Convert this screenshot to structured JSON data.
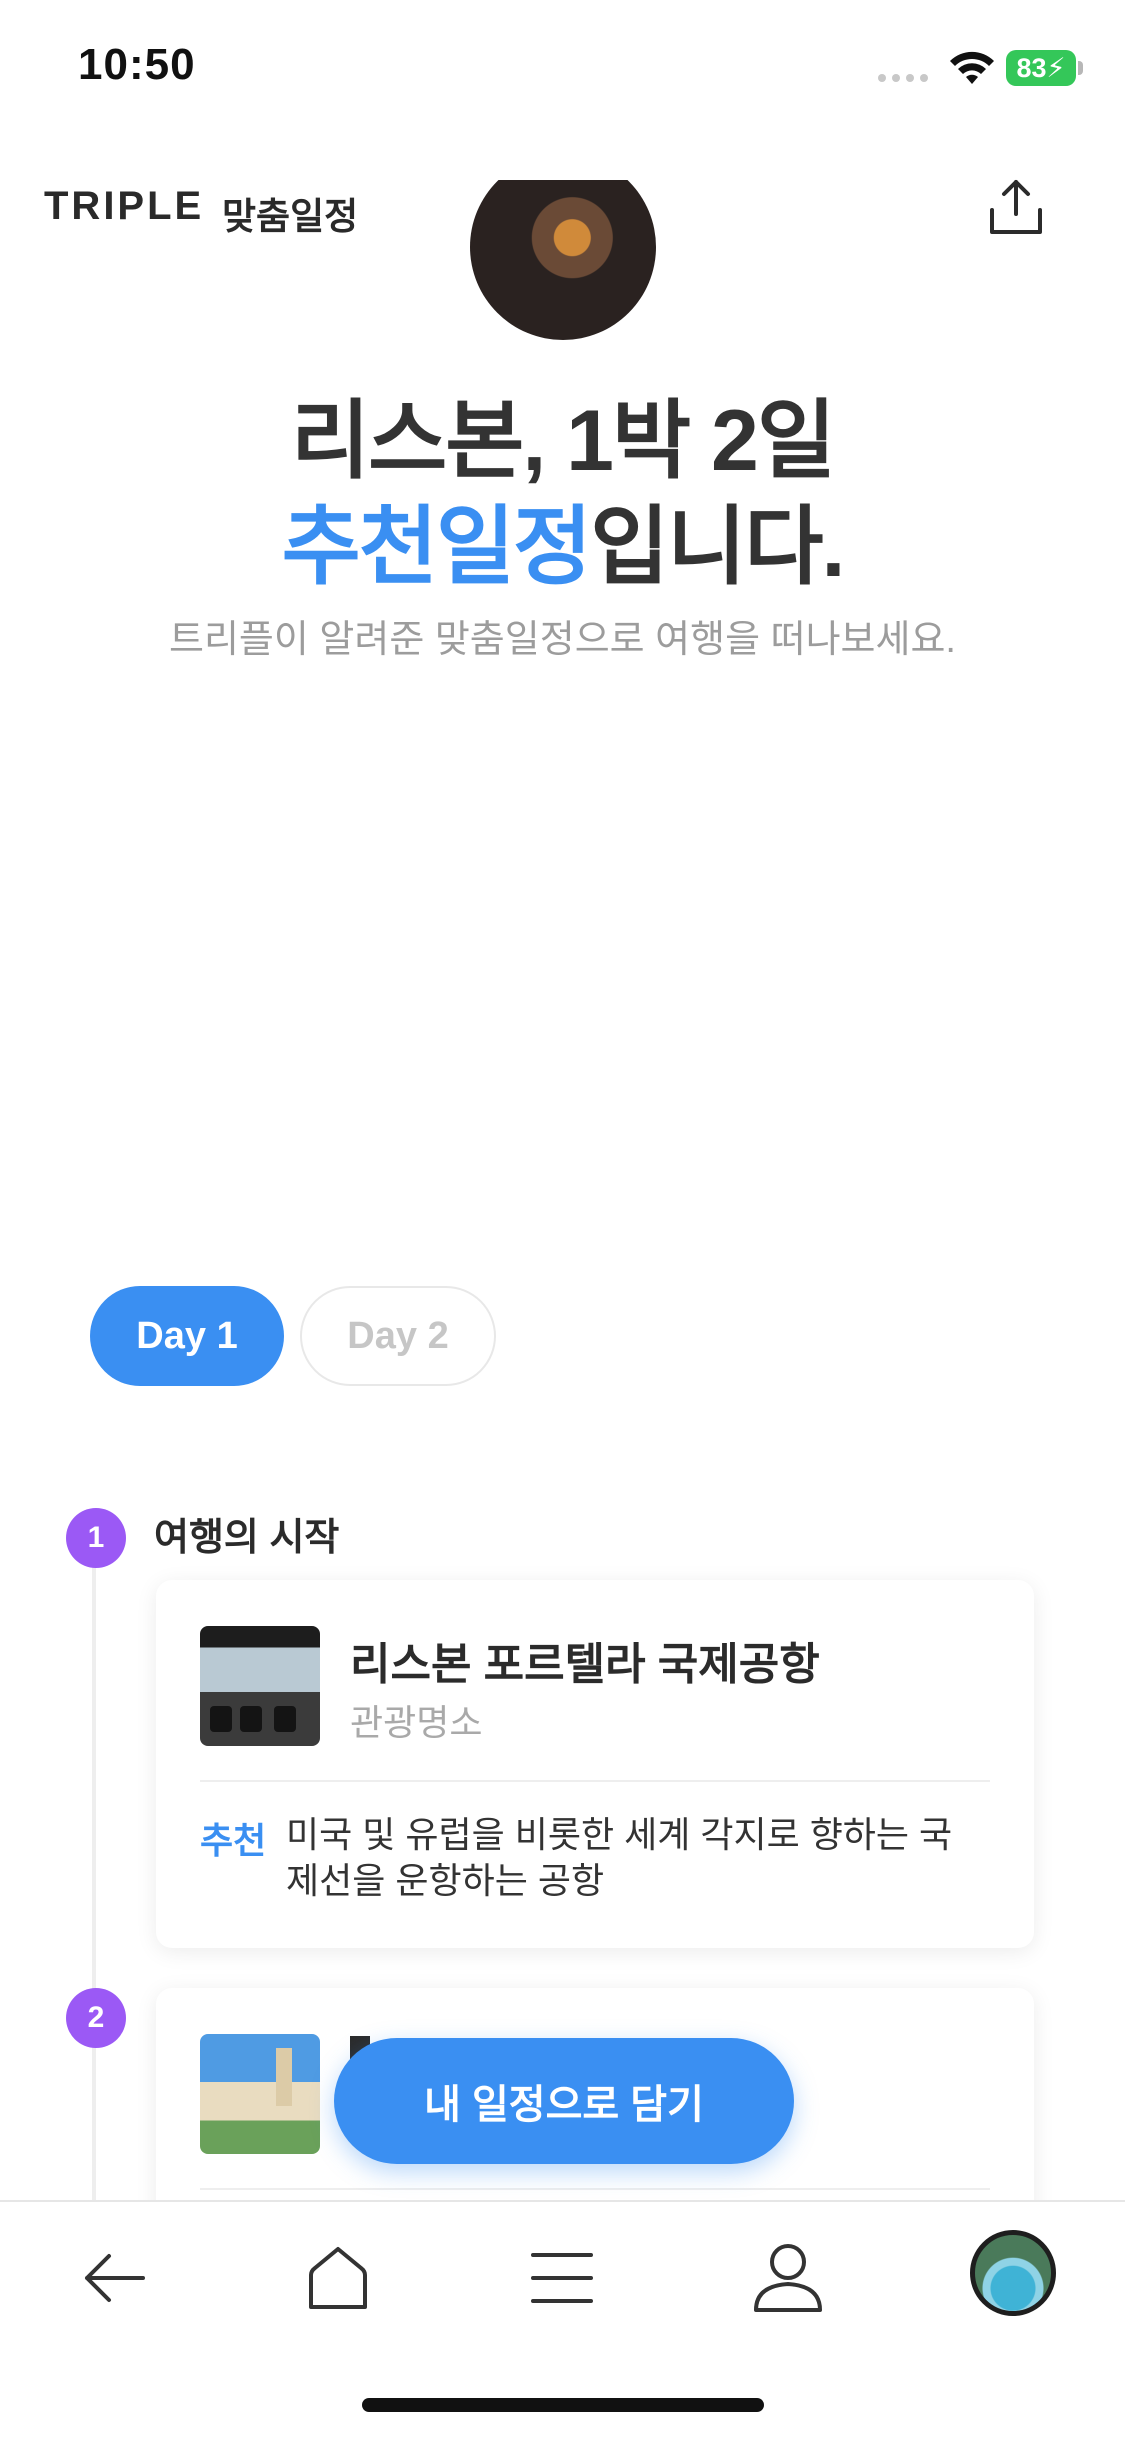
{
  "status_bar": {
    "time": "10:50",
    "battery": "83"
  },
  "header": {
    "logo": "TRIPLE",
    "logo_sub": "맞춤일정"
  },
  "hero": {
    "title_line1": "리스본, 1박 2일",
    "title_highlight": "추천일정",
    "title_suffix": "입니다.",
    "subtitle": "트리플이 알려준 맞춤일정으로 여행을 떠나보세요."
  },
  "days": {
    "tab1": "Day 1",
    "tab2": "Day 2",
    "selected": "Day 1"
  },
  "timeline": {
    "step1_number": "1",
    "step1_label": "여행의 시작",
    "step2_number": "2"
  },
  "card1": {
    "place_name": "리스본 포르텔라 국제공항",
    "category": "관광명소",
    "rec_tag": "추천",
    "rec_text": "미국 및 유럽을 비롯한 세계 각지로 향하는 국제선을 운항하는 공항"
  },
  "cta": {
    "label": "내 일정으로 담기"
  },
  "colors": {
    "accent": "#3a8ff2",
    "step_badge": "#9b59f5",
    "battery": "#34c759"
  },
  "icons": {
    "share": "share-icon",
    "back": "arrow-left-icon",
    "home": "home-icon",
    "menu": "menu-icon",
    "profile": "user-icon"
  }
}
